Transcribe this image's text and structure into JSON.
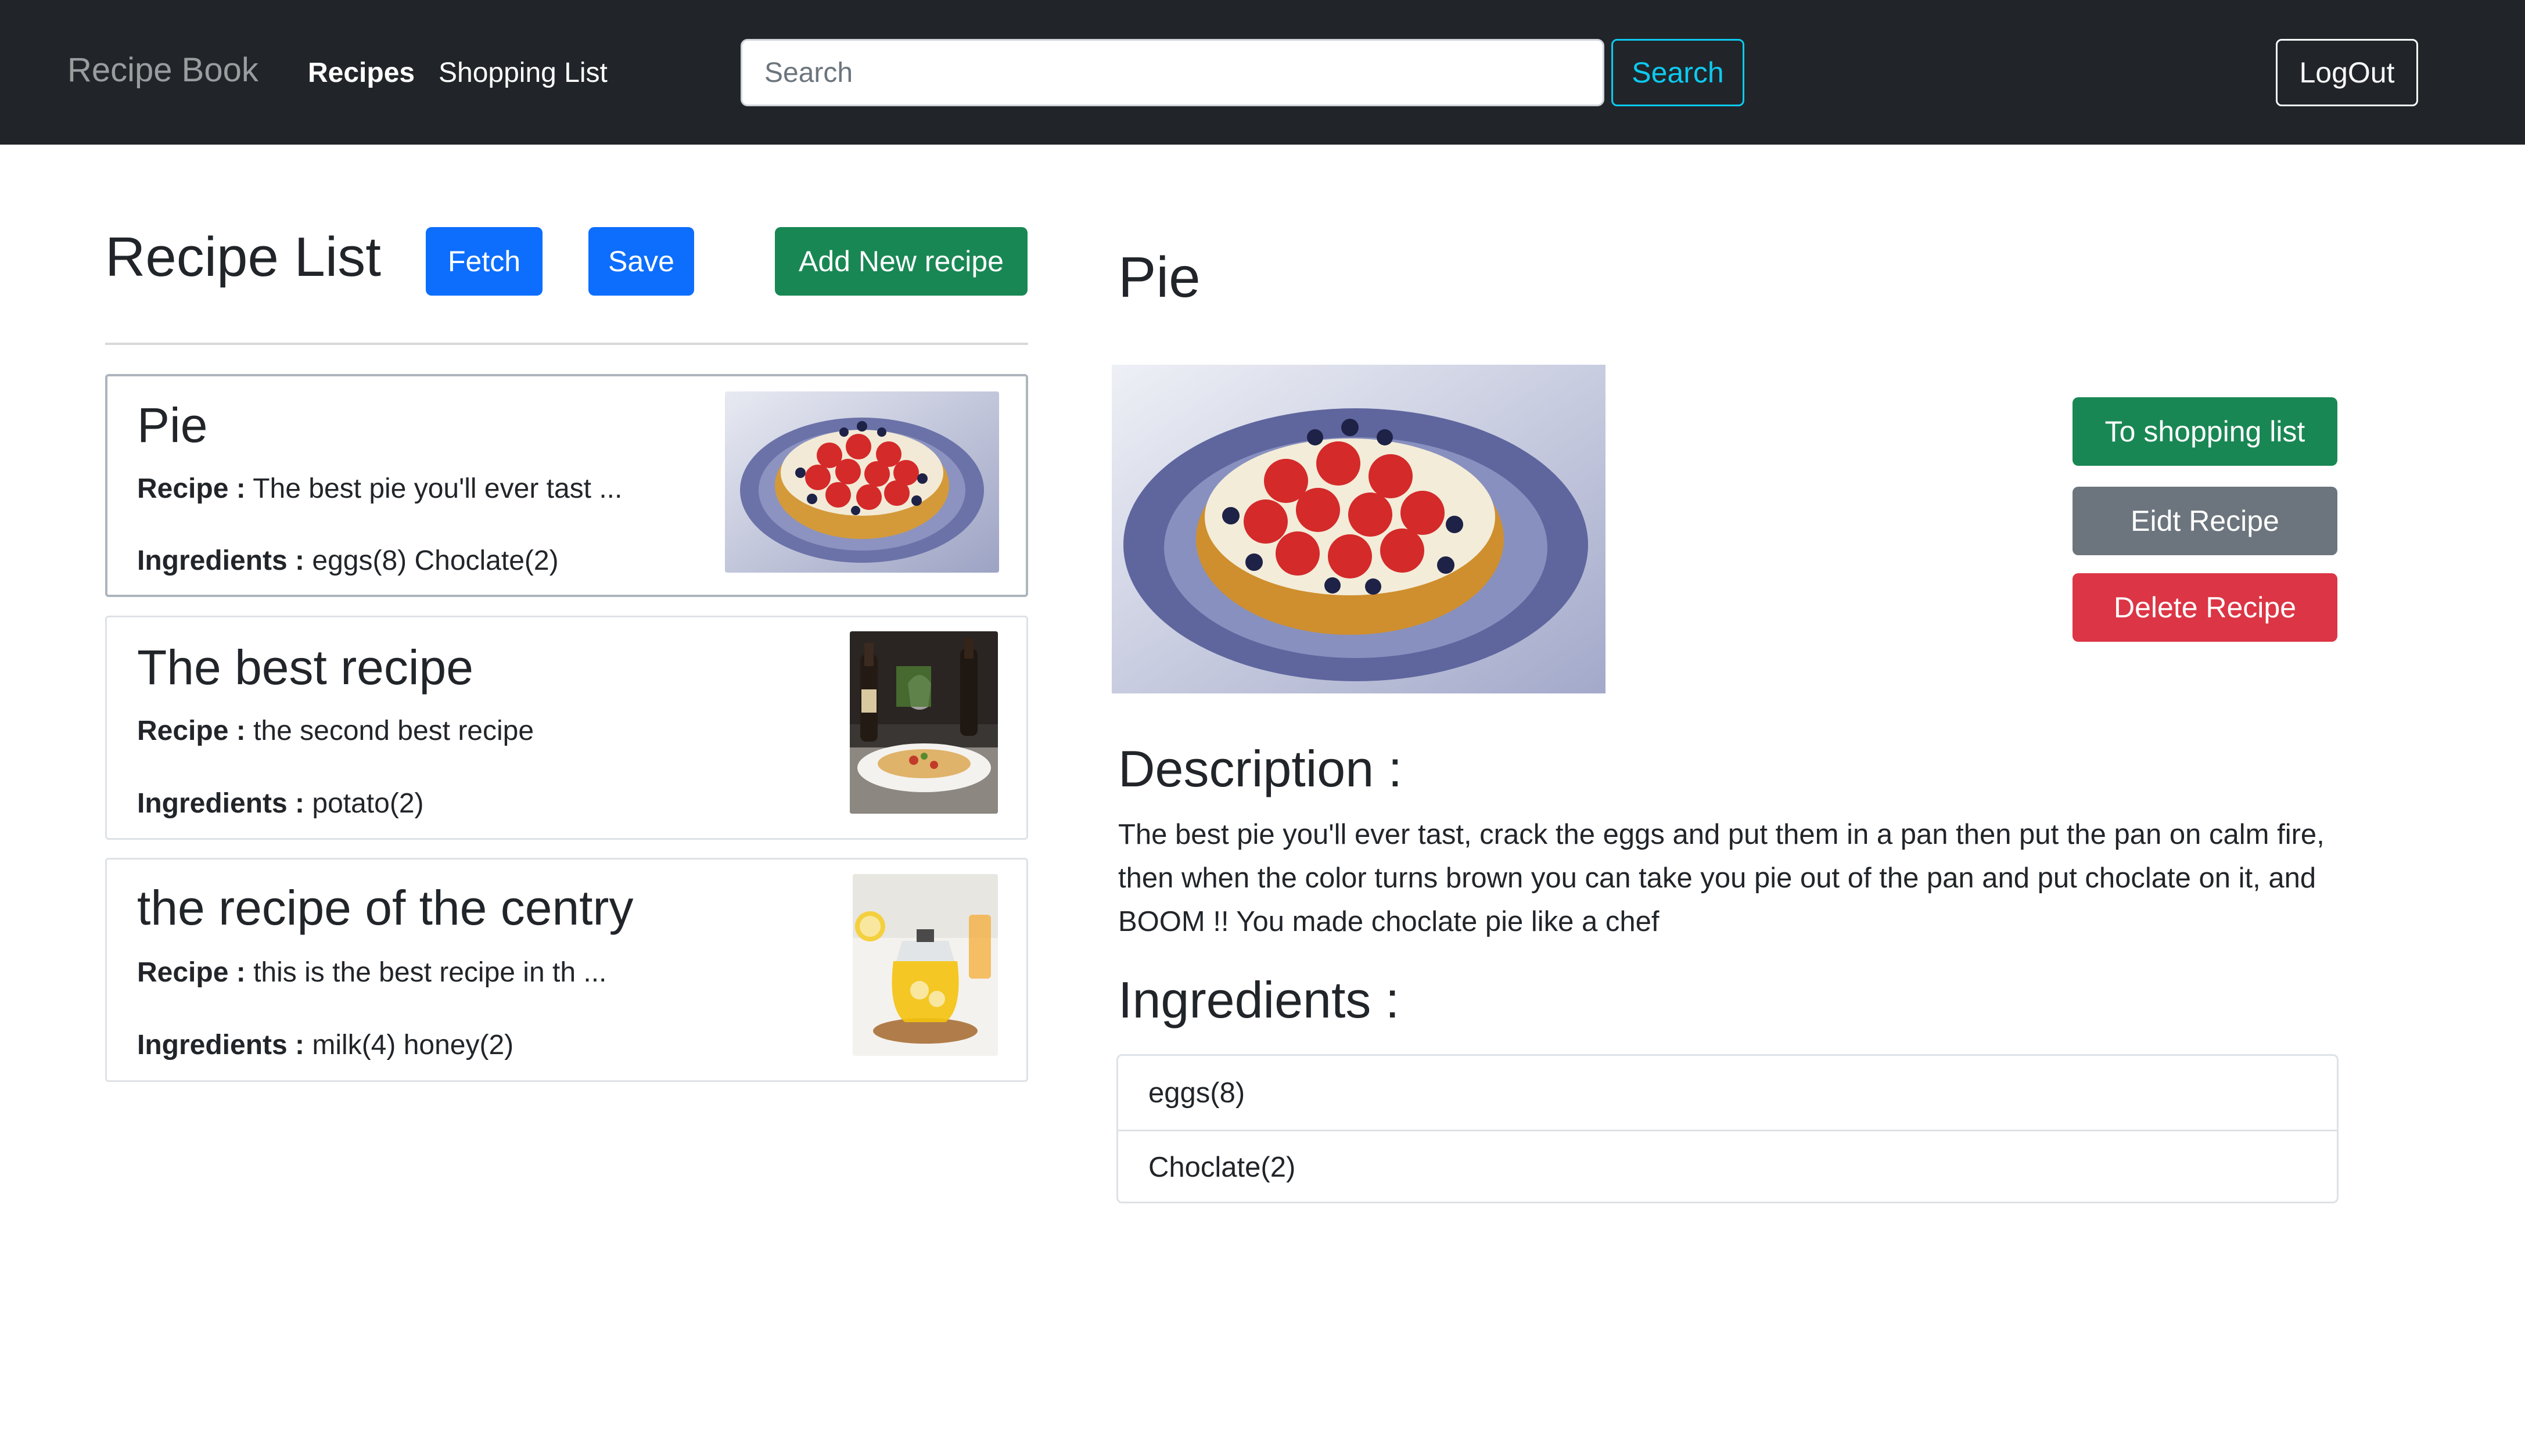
{
  "navbar": {
    "brand": "Recipe Book",
    "links": [
      {
        "label": "Recipes",
        "active": true
      },
      {
        "label": "Shopping List",
        "active": false
      }
    ],
    "search_placeholder": "Search",
    "search_button": "Search",
    "logout_button": "LogOut"
  },
  "recipe_list": {
    "title": "Recipe List",
    "buttons": {
      "fetch": "Fetch",
      "save": "Save",
      "add": "Add New recipe"
    },
    "recipe_prefix": "Recipe :",
    "ingredients_prefix": "Ingredients :",
    "items": [
      {
        "name": "Pie",
        "recipe": "The best pie you'll ever tast ...",
        "ingredients": "eggs(8) Choclate(2)",
        "thumb": "strawberry-tart-image"
      },
      {
        "name": "The best recipe",
        "recipe": "the second best recipe",
        "ingredients": "potato(2)",
        "thumb": "pasta-wine-image"
      },
      {
        "name": "the recipe of the centry",
        "recipe": "this is the best recipe in th ...",
        "ingredients": "milk(4) honey(2)",
        "thumb": "lemon-tea-image"
      }
    ]
  },
  "detail": {
    "name": "Pie",
    "image": "strawberry-tart-image",
    "buttons": {
      "shopping": "To shopping list",
      "edit": "Eidt Recipe",
      "delete": "Delete Recipe"
    },
    "description_heading": "Description :",
    "description": "The best pie you'll ever tast, crack the eggs and put them in a pan then put the pan on calm fire, then when the color turns brown you can take you pie out of the pan and put choclate on it, and BOOM !! You made choclate pie like a chef",
    "ingredients_heading": "Ingredients :",
    "ingredients": [
      "eggs(8)",
      "Choclate(2)"
    ]
  },
  "colors": {
    "navbar": "#212529",
    "primary": "#0d6efd",
    "success": "#198754",
    "secondary": "#6c757d",
    "danger": "#dc3545",
    "info": "#0dcaf0"
  }
}
